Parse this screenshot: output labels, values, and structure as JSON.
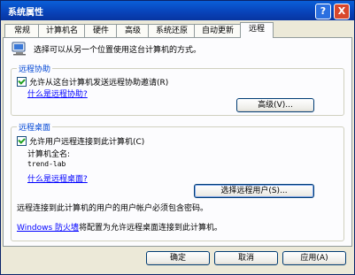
{
  "window": {
    "title": "系统属性",
    "help_glyph": "?",
    "close_glyph": "X"
  },
  "tabs": [
    "常规",
    "计算机名",
    "硬件",
    "高级",
    "系统还原",
    "自动更新",
    "远程"
  ],
  "intro_text": "选择可以从另一个位置使用这台计算机的方式。",
  "remote_assistance": {
    "group_label": "远程协助",
    "checkbox_label": "允许从这台计算机发送远程协助邀请(R)",
    "checked": true,
    "help_link": "什么是远程协助?",
    "advanced_button": "高级(V)..."
  },
  "remote_desktop": {
    "group_label": "远程桌面",
    "checkbox_label": "允许用户远程连接到此计算机(C)",
    "checked": true,
    "full_name_label": "计算机全名:",
    "computer_name": "trend-lab",
    "help_link": "什么是远程桌面?",
    "select_users_button": "选择远程用户(S)...",
    "password_note": "远程连接到此计算机的用户的用户帐户必须包含密码。",
    "firewall_link": "Windows 防火墙",
    "firewall_note": "将配置为允许远程桌面连接到此计算机。"
  },
  "footer": {
    "ok": "确定",
    "cancel": "取消",
    "apply": "应用(A)"
  },
  "colors": {
    "title_bar": "#0842b8",
    "link": "#0000ff",
    "group_label": "#0046d5",
    "check": "#21a121"
  }
}
